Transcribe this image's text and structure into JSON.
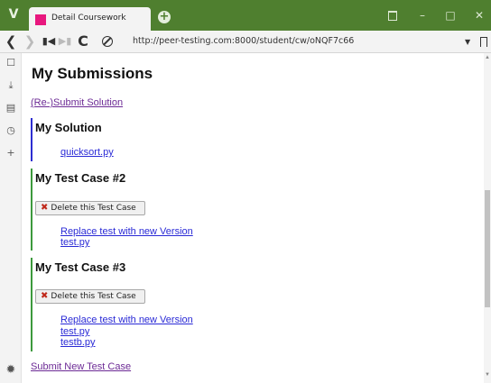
{
  "browser": {
    "logo": "V",
    "tab_title": "Detail Coursework",
    "new_tab_glyph": "+",
    "url": "http://peer-testing.com:8000/student/cw/oNQF7c66",
    "accent_color": "#4f7f2f",
    "icons": [
      "vivaldi-logo-icon",
      "trash-icon",
      "minimize-icon",
      "maximize-icon",
      "close-icon",
      "back-icon",
      "forward-icon",
      "rewind-icon",
      "fast-forward-icon",
      "reload-icon",
      "site-info-icon",
      "bookmark-icon"
    ]
  },
  "sidepanel": {
    "icons": [
      "bookmarks-icon",
      "downloads-icon",
      "notes-icon",
      "history-icon",
      "add-panel-icon",
      "settings-icon"
    ]
  },
  "page": {
    "heading": "My Submissions",
    "resubmit_link": "(Re-)Submit Solution",
    "solution": {
      "title": "My Solution",
      "file": "quicksort.py"
    },
    "test_cases": [
      {
        "title": "My Test Case #2",
        "delete_label": "Delete this Test Case",
        "replace_link": "Replace test with new Version",
        "files": [
          "test.py"
        ]
      },
      {
        "title": "My Test Case #3",
        "delete_label": "Delete this Test Case",
        "replace_link": "Replace test with new Version",
        "files": [
          "test.py",
          "testb.py"
        ]
      }
    ],
    "submit_new_link": "Submit New Test Case"
  }
}
